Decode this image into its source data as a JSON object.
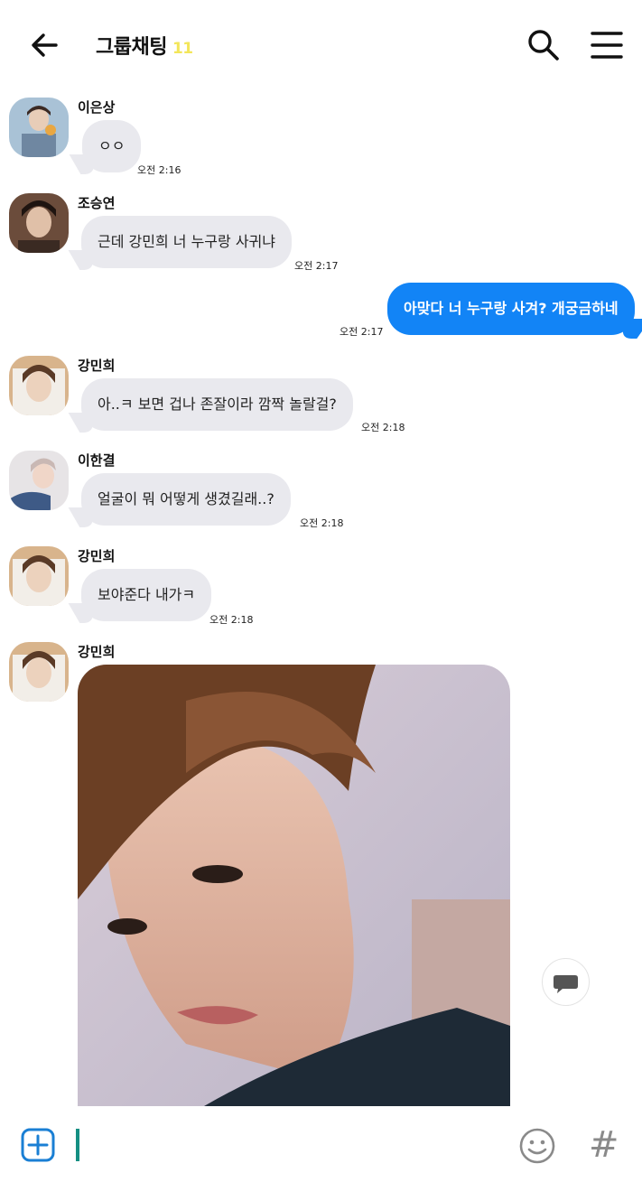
{
  "header": {
    "title": "그룹채팅",
    "member_count": "11"
  },
  "messages": [
    {
      "sender": "이은상",
      "text": "ㅇㅇ",
      "time": "오전 2:16"
    },
    {
      "sender": "조승연",
      "text": "근데 강민희 너 누구랑 사귀냐",
      "time": "오전 2:17"
    },
    {
      "sender": "me",
      "text": "아맞다 너 누구랑 사겨? 개궁금하네",
      "time": "오전 2:17"
    },
    {
      "sender": "강민희",
      "text": "아..ㅋ 보면 겁나 존잘이라 깜짝 놀랄걸?",
      "time": "오전 2:18"
    },
    {
      "sender": "이한결",
      "text": "얼굴이 뭐 어떻게 생겼길래..?",
      "time": "오전 2:18"
    },
    {
      "sender": "강민희",
      "text": "보야준다 내가ㅋ",
      "time": "오전 2:18"
    },
    {
      "sender": "강민희",
      "text": "",
      "time": ""
    }
  ],
  "icons": {
    "back": "arrow-left-icon",
    "search": "search-icon",
    "menu": "hamburger-menu-icon",
    "attach": "plus-box-icon",
    "emoji": "smiley-icon",
    "hashtag": "hashtag-icon",
    "reply": "speech-bubble-icon"
  },
  "input": {
    "hash_symbol": "#"
  },
  "colors": {
    "outgoing_bubble": "#1284f6",
    "incoming_bubble": "#e9e9ee",
    "member_count": "#f3e65a",
    "cursor": "#148f83",
    "attach_icon": "#1a7fd4"
  }
}
